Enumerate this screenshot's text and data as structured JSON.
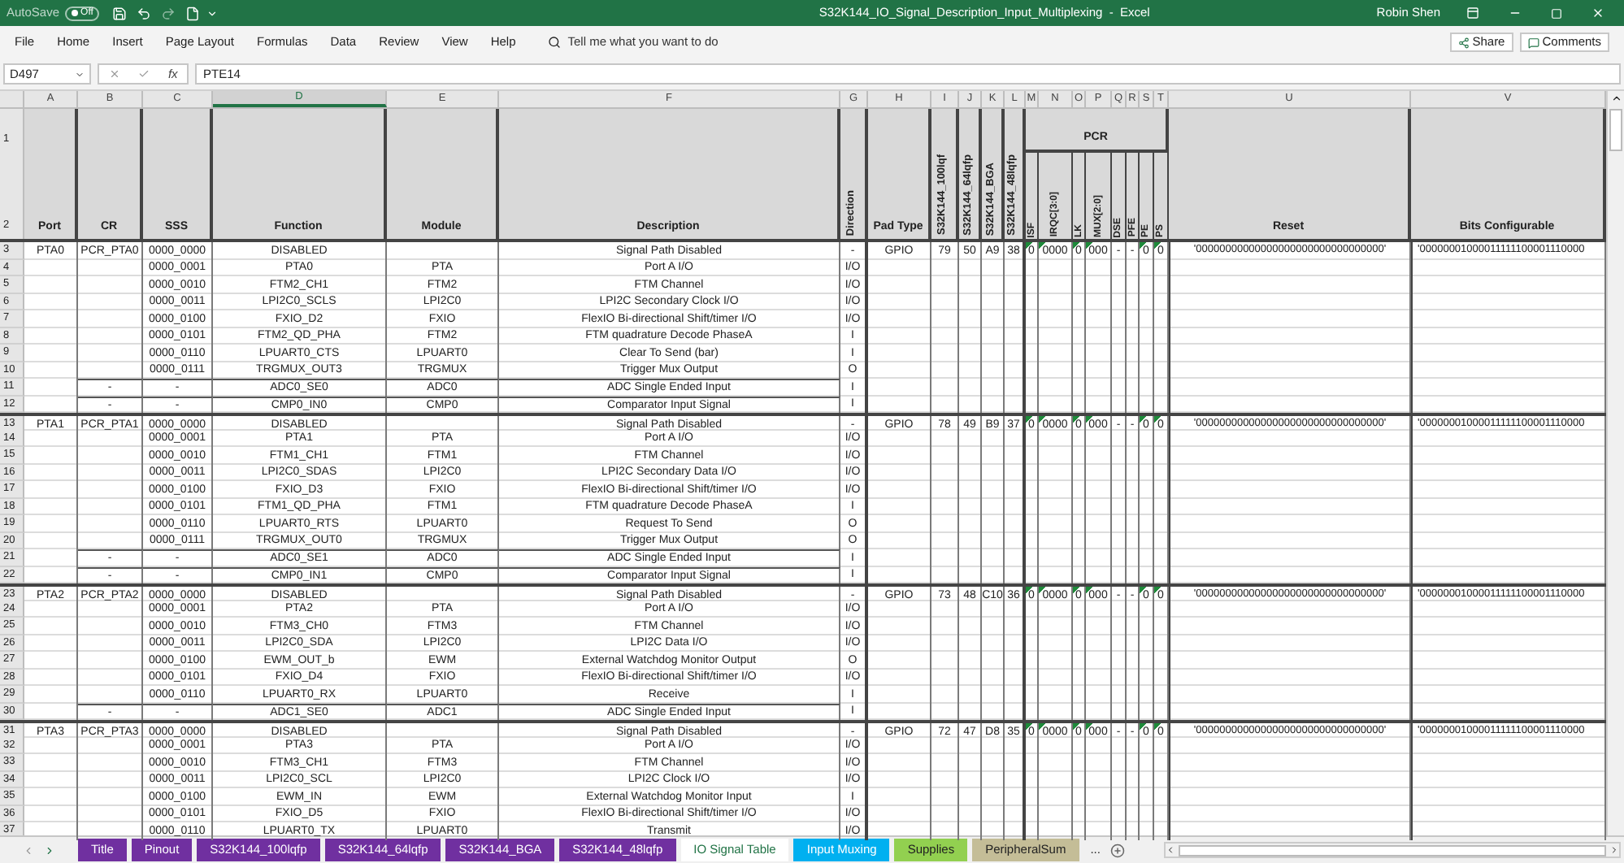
{
  "title_bar": {
    "autosave": {
      "label": "AutoSave",
      "on": false,
      "state_text": "Off"
    },
    "title": "S32K144_IO_Signal_Description_Input_Multiplexing  -  Excel",
    "user": "Robin Shen"
  },
  "ribbon": {
    "tabs": [
      "File",
      "Home",
      "Insert",
      "Page Layout",
      "Formulas",
      "Data",
      "Review",
      "View",
      "Help"
    ],
    "search_placeholder": "Tell me what you want to do",
    "share": "Share",
    "comments": "Comments"
  },
  "formula_bar": {
    "name_box": "D497",
    "function_label": "fx",
    "value": "PTE14"
  },
  "columns": [
    {
      "letter": "A",
      "selected": false
    },
    {
      "letter": "B",
      "selected": false
    },
    {
      "letter": "C",
      "selected": false
    },
    {
      "letter": "D",
      "selected": true
    },
    {
      "letter": "E",
      "selected": false
    },
    {
      "letter": "F",
      "selected": false
    },
    {
      "letter": "G",
      "selected": false
    },
    {
      "letter": "H",
      "selected": false
    },
    {
      "letter": "I",
      "selected": false
    },
    {
      "letter": "J",
      "selected": false
    },
    {
      "letter": "K",
      "selected": false
    },
    {
      "letter": "L",
      "selected": false
    },
    {
      "letter": "M",
      "selected": false
    },
    {
      "letter": "N",
      "selected": false
    },
    {
      "letter": "O",
      "selected": false
    },
    {
      "letter": "P",
      "selected": false
    },
    {
      "letter": "Q",
      "selected": false
    },
    {
      "letter": "R",
      "selected": false
    },
    {
      "letter": "S",
      "selected": false
    },
    {
      "letter": "T",
      "selected": false
    },
    {
      "letter": "U",
      "selected": false
    },
    {
      "letter": "V",
      "selected": false
    }
  ],
  "header": {
    "row_numbers": [
      "1",
      "2"
    ],
    "titles": [
      {
        "label": "Port",
        "kind": "horizontal"
      },
      {
        "label": "CR",
        "kind": "horizontal"
      },
      {
        "label": "SSS",
        "kind": "horizontal"
      },
      {
        "label": "Function",
        "kind": "horizontal"
      },
      {
        "label": "Module",
        "kind": "horizontal"
      },
      {
        "label": "Description",
        "kind": "horizontal"
      },
      {
        "label": "Direction",
        "kind": "vertical"
      },
      {
        "label": "Pad Type",
        "kind": "horizontal"
      },
      {
        "label": "S32K144_100lqf",
        "kind": "vertical"
      },
      {
        "label": "S32K144_64lqfp",
        "kind": "vertical"
      },
      {
        "label": "S32K144_BGA",
        "kind": "vertical"
      },
      {
        "label": "S32K144_48lqfp",
        "kind": "vertical"
      }
    ],
    "pcr": {
      "label": "PCR",
      "fields": [
        "ISF",
        "IRQC[3:0]",
        "LK",
        "MUX[2:0]",
        "DSE",
        "PFE",
        "PE",
        "PS"
      ]
    },
    "tail_titles": [
      "Reset",
      "Bits Configurable"
    ]
  },
  "groups": [
    {
      "port": "PTA0",
      "cr": "PCR_PTA0",
      "pad_type": "GPIO",
      "pins": [
        "79",
        "50",
        "A9",
        "38"
      ],
      "pcr": [
        {
          "value": "0",
          "flagged": true
        },
        {
          "value": "0000",
          "flagged": true
        },
        {
          "value": "0",
          "flagged": true
        },
        {
          "value": "000",
          "flagged": true
        },
        {
          "value": "-",
          "flagged": false
        },
        {
          "value": "-",
          "flagged": false
        },
        {
          "value": "0",
          "flagged": true
        },
        {
          "value": "0",
          "flagged": true
        }
      ],
      "reset": "'00000000000000000000000000000000'",
      "bits": "'00000001000011111100001110000",
      "rows": [
        {
          "n": "3",
          "kind": "mux",
          "sss": "0000_0000",
          "function": "DISABLED",
          "description": "Signal Path Disabled",
          "direction": "-"
        },
        {
          "n": "4",
          "kind": "mux",
          "sss": "0000_0001",
          "function": "PTA0",
          "module": "PTA",
          "description": "Port A I/O",
          "direction": "I/O"
        },
        {
          "n": "5",
          "kind": "mux",
          "sss": "0000_0010",
          "function": "FTM2_CH1",
          "module": "FTM2",
          "description": "FTM Channel",
          "direction": "I/O"
        },
        {
          "n": "6",
          "kind": "mux",
          "sss": "0000_0011",
          "function": "LPI2C0_SCLS",
          "module": "LPI2C0",
          "description": "LPI2C Secondary Clock I/O",
          "direction": "I/O"
        },
        {
          "n": "7",
          "kind": "mux",
          "sss": "0000_0100",
          "function": "FXIO_D2",
          "module": "FXIO",
          "description": "FlexIO Bi-directional Shift/timer I/O",
          "direction": "I/O"
        },
        {
          "n": "8",
          "kind": "mux",
          "sss": "0000_0101",
          "function": "FTM2_QD_PHA",
          "module": "FTM2",
          "description": "FTM quadrature Decode PhaseA",
          "direction": "I"
        },
        {
          "n": "9",
          "kind": "mux",
          "sss": "0000_0110",
          "function": "LPUART0_CTS",
          "module": "LPUART0",
          "description": "Clear To Send (bar)",
          "direction": "I"
        },
        {
          "n": "10",
          "kind": "mux",
          "sss": "0000_0111",
          "function": "TRGMUX_OUT3",
          "module": "TRGMUX",
          "description": "Trigger Mux Output",
          "direction": "O"
        },
        {
          "n": "11",
          "kind": "fixed",
          "cr": "-",
          "sss": "-",
          "function": "ADC0_SE0",
          "module": "ADC0",
          "description": "ADC Single Ended Input",
          "direction": "I"
        },
        {
          "n": "12",
          "kind": "fixed",
          "cr": "-",
          "sss": "-",
          "function": "CMP0_IN0",
          "module": "CMP0",
          "description": "Comparator Input Signal",
          "direction": "I"
        }
      ]
    },
    {
      "port": "PTA1",
      "cr": "PCR_PTA1",
      "pad_type": "GPIO",
      "pins": [
        "78",
        "49",
        "B9",
        "37"
      ],
      "pcr": [
        {
          "value": "0",
          "flagged": true
        },
        {
          "value": "0000",
          "flagged": true
        },
        {
          "value": "0",
          "flagged": true
        },
        {
          "value": "000",
          "flagged": true
        },
        {
          "value": "-",
          "flagged": false
        },
        {
          "value": "-",
          "flagged": false
        },
        {
          "value": "0",
          "flagged": true
        },
        {
          "value": "0",
          "flagged": true
        }
      ],
      "reset": "'00000000000000000000000000000000'",
      "bits": "'00000001000011111100001110000",
      "rows": [
        {
          "n": "13",
          "kind": "mux",
          "sss": "0000_0000",
          "function": "DISABLED",
          "description": "Signal Path Disabled",
          "direction": "-"
        },
        {
          "n": "14",
          "kind": "mux",
          "sss": "0000_0001",
          "function": "PTA1",
          "module": "PTA",
          "description": "Port A I/O",
          "direction": "I/O"
        },
        {
          "n": "15",
          "kind": "mux",
          "sss": "0000_0010",
          "function": "FTM1_CH1",
          "module": "FTM1",
          "description": "FTM Channel",
          "direction": "I/O"
        },
        {
          "n": "16",
          "kind": "mux",
          "sss": "0000_0011",
          "function": "LPI2C0_SDAS",
          "module": "LPI2C0",
          "description": "LPI2C Secondary Data I/O",
          "direction": "I/O"
        },
        {
          "n": "17",
          "kind": "mux",
          "sss": "0000_0100",
          "function": "FXIO_D3",
          "module": "FXIO",
          "description": "FlexIO Bi-directional Shift/timer I/O",
          "direction": "I/O"
        },
        {
          "n": "18",
          "kind": "mux",
          "sss": "0000_0101",
          "function": "FTM1_QD_PHA",
          "module": "FTM1",
          "description": "FTM quadrature Decode PhaseA",
          "direction": "I"
        },
        {
          "n": "19",
          "kind": "mux",
          "sss": "0000_0110",
          "function": "LPUART0_RTS",
          "module": "LPUART0",
          "description": "Request To Send",
          "direction": "O"
        },
        {
          "n": "20",
          "kind": "mux",
          "sss": "0000_0111",
          "function": "TRGMUX_OUT0",
          "module": "TRGMUX",
          "description": "Trigger Mux Output",
          "direction": "O"
        },
        {
          "n": "21",
          "kind": "fixed",
          "cr": "-",
          "sss": "-",
          "function": "ADC0_SE1",
          "module": "ADC0",
          "description": "ADC Single Ended Input",
          "direction": "I"
        },
        {
          "n": "22",
          "kind": "fixed",
          "cr": "-",
          "sss": "-",
          "function": "CMP0_IN1",
          "module": "CMP0",
          "description": "Comparator Input Signal",
          "direction": "I"
        }
      ]
    },
    {
      "port": "PTA2",
      "cr": "PCR_PTA2",
      "pad_type": "GPIO",
      "pins": [
        "73",
        "48",
        "C10",
        "36"
      ],
      "pcr": [
        {
          "value": "0",
          "flagged": true
        },
        {
          "value": "0000",
          "flagged": true
        },
        {
          "value": "0",
          "flagged": true
        },
        {
          "value": "000",
          "flagged": true
        },
        {
          "value": "-",
          "flagged": false
        },
        {
          "value": "-",
          "flagged": false
        },
        {
          "value": "0",
          "flagged": true
        },
        {
          "value": "0",
          "flagged": true
        }
      ],
      "reset": "'00000000000000000000000000000000'",
      "bits": "'00000001000011111100001110000",
      "rows": [
        {
          "n": "23",
          "kind": "mux",
          "sss": "0000_0000",
          "function": "DISABLED",
          "description": "Signal Path Disabled",
          "direction": "-"
        },
        {
          "n": "24",
          "kind": "mux",
          "sss": "0000_0001",
          "function": "PTA2",
          "module": "PTA",
          "description": "Port A I/O",
          "direction": "I/O"
        },
        {
          "n": "25",
          "kind": "mux",
          "sss": "0000_0010",
          "function": "FTM3_CH0",
          "module": "FTM3",
          "description": "FTM Channel",
          "direction": "I/O"
        },
        {
          "n": "26",
          "kind": "mux",
          "sss": "0000_0011",
          "function": "LPI2C0_SDA",
          "module": "LPI2C0",
          "description": "LPI2C Data I/O",
          "direction": "I/O"
        },
        {
          "n": "27",
          "kind": "mux",
          "sss": "0000_0100",
          "function": "EWM_OUT_b",
          "module": "EWM",
          "description": "External Watchdog Monitor Output",
          "direction": "O"
        },
        {
          "n": "28",
          "kind": "mux",
          "sss": "0000_0101",
          "function": "FXIO_D4",
          "module": "FXIO",
          "description": "FlexIO Bi-directional Shift/timer I/O",
          "direction": "I/O"
        },
        {
          "n": "29",
          "kind": "mux",
          "sss": "0000_0110",
          "function": "LPUART0_RX",
          "module": "LPUART0",
          "description": "Receive",
          "direction": "I"
        },
        {
          "n": "30",
          "kind": "fixed",
          "cr": "-",
          "sss": "-",
          "function": "ADC1_SE0",
          "module": "ADC1",
          "description": "ADC Single Ended Input",
          "direction": "I"
        }
      ]
    },
    {
      "port": "PTA3",
      "cr": "PCR_PTA3",
      "pad_type": "GPIO",
      "pins": [
        "72",
        "47",
        "D8",
        "35"
      ],
      "pcr": [
        {
          "value": "0",
          "flagged": true
        },
        {
          "value": "0000",
          "flagged": true
        },
        {
          "value": "0",
          "flagged": true
        },
        {
          "value": "000",
          "flagged": true
        },
        {
          "value": "-",
          "flagged": false
        },
        {
          "value": "-",
          "flagged": false
        },
        {
          "value": "0",
          "flagged": true
        },
        {
          "value": "0",
          "flagged": true
        }
      ],
      "reset": "'00000000000000000000000000000000'",
      "bits": "'00000001000011111100001110000",
      "rows": [
        {
          "n": "31",
          "kind": "mux",
          "sss": "0000_0000",
          "function": "DISABLED",
          "description": "Signal Path Disabled",
          "direction": "-"
        },
        {
          "n": "32",
          "kind": "mux",
          "sss": "0000_0001",
          "function": "PTA3",
          "module": "PTA",
          "description": "Port A I/O",
          "direction": "I/O"
        },
        {
          "n": "33",
          "kind": "mux",
          "sss": "0000_0010",
          "function": "FTM3_CH1",
          "module": "FTM3",
          "description": "FTM Channel",
          "direction": "I/O"
        },
        {
          "n": "34",
          "kind": "mux",
          "sss": "0000_0011",
          "function": "LPI2C0_SCL",
          "module": "LPI2C0",
          "description": "LPI2C Clock I/O",
          "direction": "I/O"
        },
        {
          "n": "35",
          "kind": "mux",
          "sss": "0000_0100",
          "function": "EWM_IN",
          "module": "EWM",
          "description": "External Watchdog Monitor Input",
          "direction": "I"
        },
        {
          "n": "36",
          "kind": "mux",
          "sss": "0000_0101",
          "function": "FXIO_D5",
          "module": "FXIO",
          "description": "FlexIO Bi-directional Shift/timer I/O",
          "direction": "I/O"
        },
        {
          "n": "37",
          "kind": "mux",
          "sss": "0000_0110",
          "function": "LPUART0_TX",
          "module": "LPUART0",
          "description": "Transmit",
          "direction": "I/O"
        }
      ]
    }
  ],
  "sheet_tabs": [
    {
      "label": "Title",
      "selected": false,
      "color": "#7030a0"
    },
    {
      "label": "Pinout",
      "selected": false,
      "color": "#7030a0"
    },
    {
      "label": "S32K144_100lqfp",
      "selected": false,
      "color": "#7030a0"
    },
    {
      "label": "S32K144_64lqfp",
      "selected": false,
      "color": "#7030a0"
    },
    {
      "label": "S32K144_BGA",
      "selected": false,
      "color": "#7030a0"
    },
    {
      "label": "S32K144_48lqfp",
      "selected": false,
      "color": "#7030a0"
    },
    {
      "label": "IO Signal Table",
      "selected": true
    },
    {
      "label": "Input Muxing",
      "selected": false,
      "color": "#00b0f0"
    },
    {
      "label": "Supplies",
      "selected": false,
      "color": "#92d050"
    },
    {
      "label": "PeripheralSum",
      "selected": false,
      "color": "#c4bd97"
    }
  ],
  "more_tabs": "..."
}
